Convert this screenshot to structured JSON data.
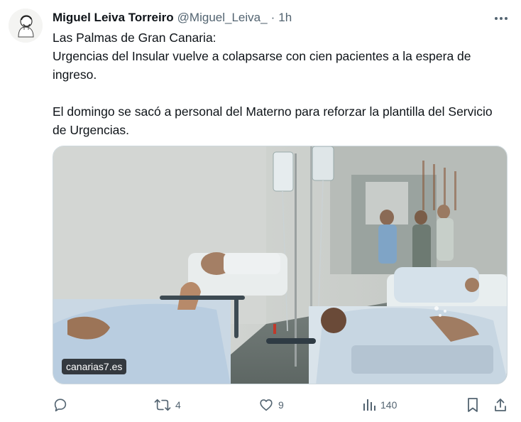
{
  "tweet": {
    "author_name": "Miguel Leiva Torreiro",
    "handle": "@Miguel_Leiva_",
    "separator": "·",
    "time": "1h",
    "text_lines": [
      "Las Palmas de Gran Canaria:",
      "Urgencias del Insular vuelve a colapsarse con cien pacientes a la espera de ingreso.",
      "El domingo se sacó a personal del Materno para reforzar la plantilla del Servicio de Urgencias."
    ],
    "media_watermark": "canarias7.es"
  },
  "actions": {
    "reply_icon": "reply-icon",
    "retweet_icon": "retweet-icon",
    "retweet_count": "4",
    "like_icon": "heart-icon",
    "like_count": "9",
    "views_icon": "views-icon",
    "views_count": "140",
    "bookmark_icon": "bookmark-icon",
    "share_icon": "share-icon"
  },
  "colors": {
    "text": "#0f1419",
    "secondary": "#536471",
    "border": "#cfd9de"
  }
}
